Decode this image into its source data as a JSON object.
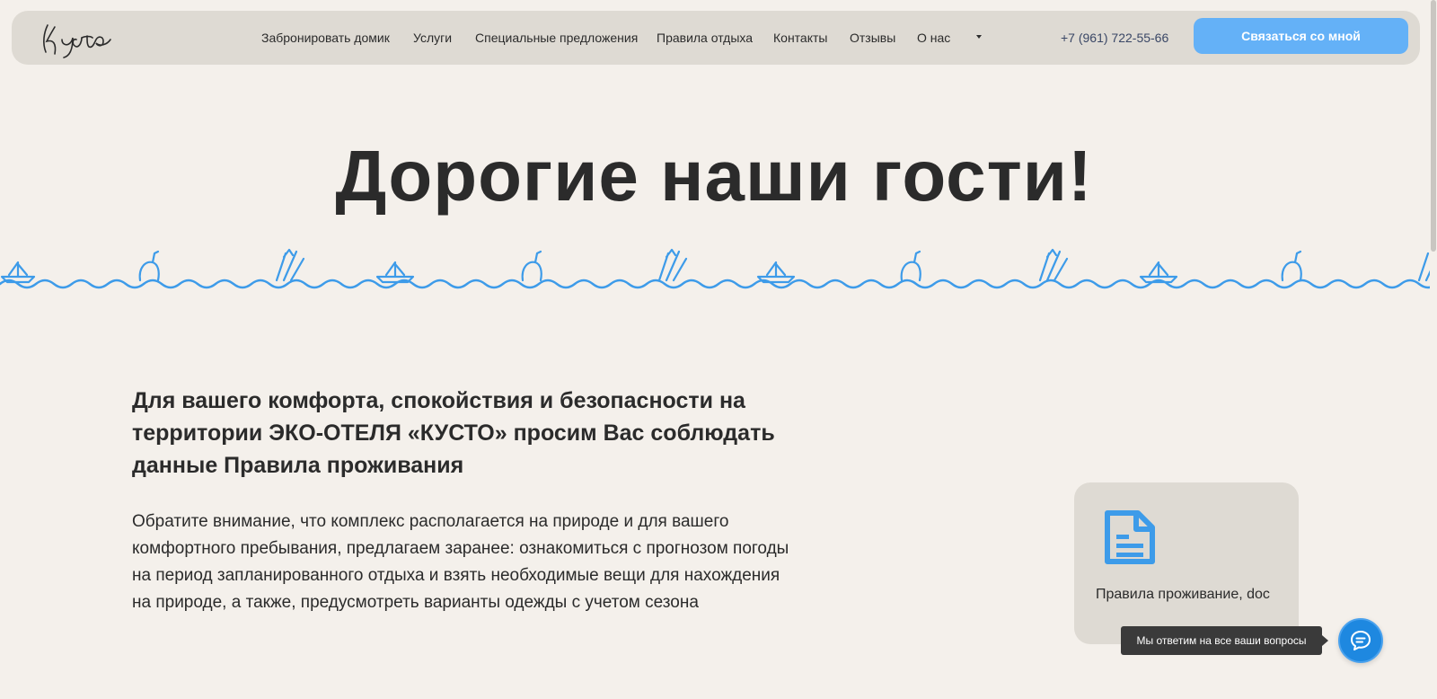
{
  "header": {
    "logo_text": "Кусто",
    "nav": [
      {
        "label": "Забронировать домик"
      },
      {
        "label": "Услуги"
      },
      {
        "label": "Специальные предложения"
      },
      {
        "label": "Правила отдыха"
      },
      {
        "label": "Контакты"
      },
      {
        "label": "Отзывы"
      },
      {
        "label": "О нас"
      }
    ],
    "phone": "+7 (961) 722-55-66",
    "cta_label": "Связаться со мной"
  },
  "hero": {
    "title": "Дорогие наши гости!"
  },
  "content": {
    "lead": "Для вашего комфорта, спокойствия и безопасности на территории ЭКО-ОТЕЛЯ «КУСТО» просим Вас соблюдать данные Правила проживания",
    "body": "Обратите внимание, что комплекс располагается на природе и для вашего комфортного пребывания, предлагаем заранее: ознакомиться с прогнозом погоды на период запланированного отдыха и взять необходимые вещи для нахождения на природе, а также, предусмотреть варианты одежды с учетом сезона"
  },
  "doc_card": {
    "label": "Правила проживание, doc",
    "icon": "document-icon"
  },
  "chat": {
    "tooltip": "Мы ответим на все ваши вопросы",
    "icon": "chat-icon"
  },
  "colors": {
    "background": "#f4f0eb",
    "header_bg": "#dedad3",
    "accent_blue": "#64b1f7",
    "wave_blue": "#3d9be9",
    "chat_blue": "#1e88e0",
    "text": "#2b2b2b"
  }
}
